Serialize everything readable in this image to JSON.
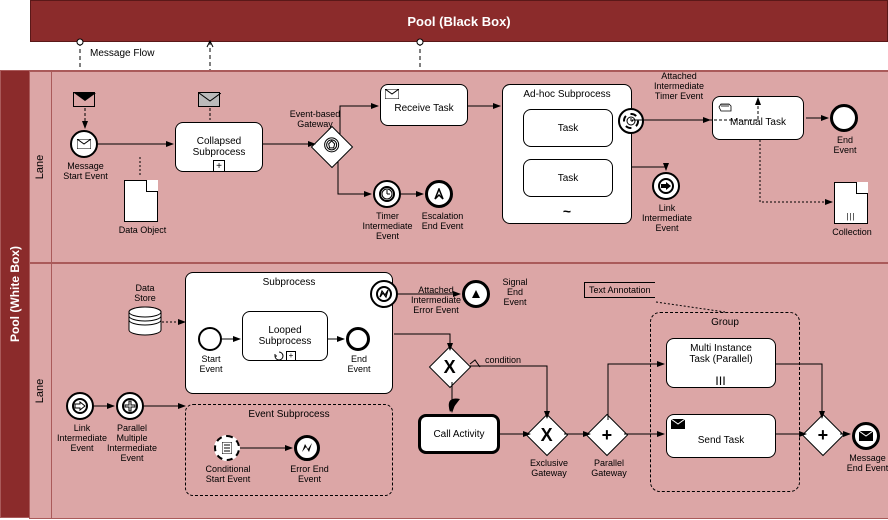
{
  "blackbox_label": "Pool (Black Box)",
  "message_flow_label": "Message Flow",
  "pool_label": "Pool (White Box)",
  "lane1": {
    "label": "Lane"
  },
  "lane2": {
    "label": "Lane"
  },
  "lane1_elems": {
    "msg_start": "Message\nStart Event",
    "data_object": "Data Object",
    "collapsed_sub": "Collapsed\nSubprocess",
    "event_gateway": "Event-based\nGateway",
    "receive_task": "Receive Task",
    "timer_inter": "Timer\nIntermediate\nEvent",
    "escalation_end": "Escalation\nEnd Event",
    "adhoc": "Ad-hoc Subprocess",
    "adhoc_task1": "Task",
    "adhoc_task2": "Task",
    "attached_timer": "Attached\nIntermediate\nTimer Event",
    "link_inter": "Link\nIntermediate\nEvent",
    "manual_task": "Manual Task",
    "end_event": "End\nEvent",
    "collection": "Collection"
  },
  "lane2_elems": {
    "link_inter": "Link\nIntermediate\nEvent",
    "parallel_multi": "Parallel\nMultiple\nIntermediate\nEvent",
    "data_store": "Data\nStore",
    "subprocess": "Subprocess",
    "start_event": "Start\nEvent",
    "looped_sub": "Looped\nSubprocess",
    "end_event_sub": "End\nEvent",
    "event_sub": "Event Subprocess",
    "cond_start": "Conditional\nStart Event",
    "error_end": "Error End\nEvent",
    "attached_error": "Attached\nIntermediate\nError Event",
    "signal_end": "Signal\nEnd\nEvent",
    "condition": "condition",
    "call_activity": "Call Activity",
    "exclusive_gw": "Exclusive\nGateway",
    "parallel_gw": "Parallel\nGateway",
    "text_annotation": "Text Annotation",
    "group": "Group",
    "multi_instance": "Multi Instance\nTask (Parallel)",
    "send_task": "Send Task",
    "msg_end": "Message\nEnd Event"
  }
}
